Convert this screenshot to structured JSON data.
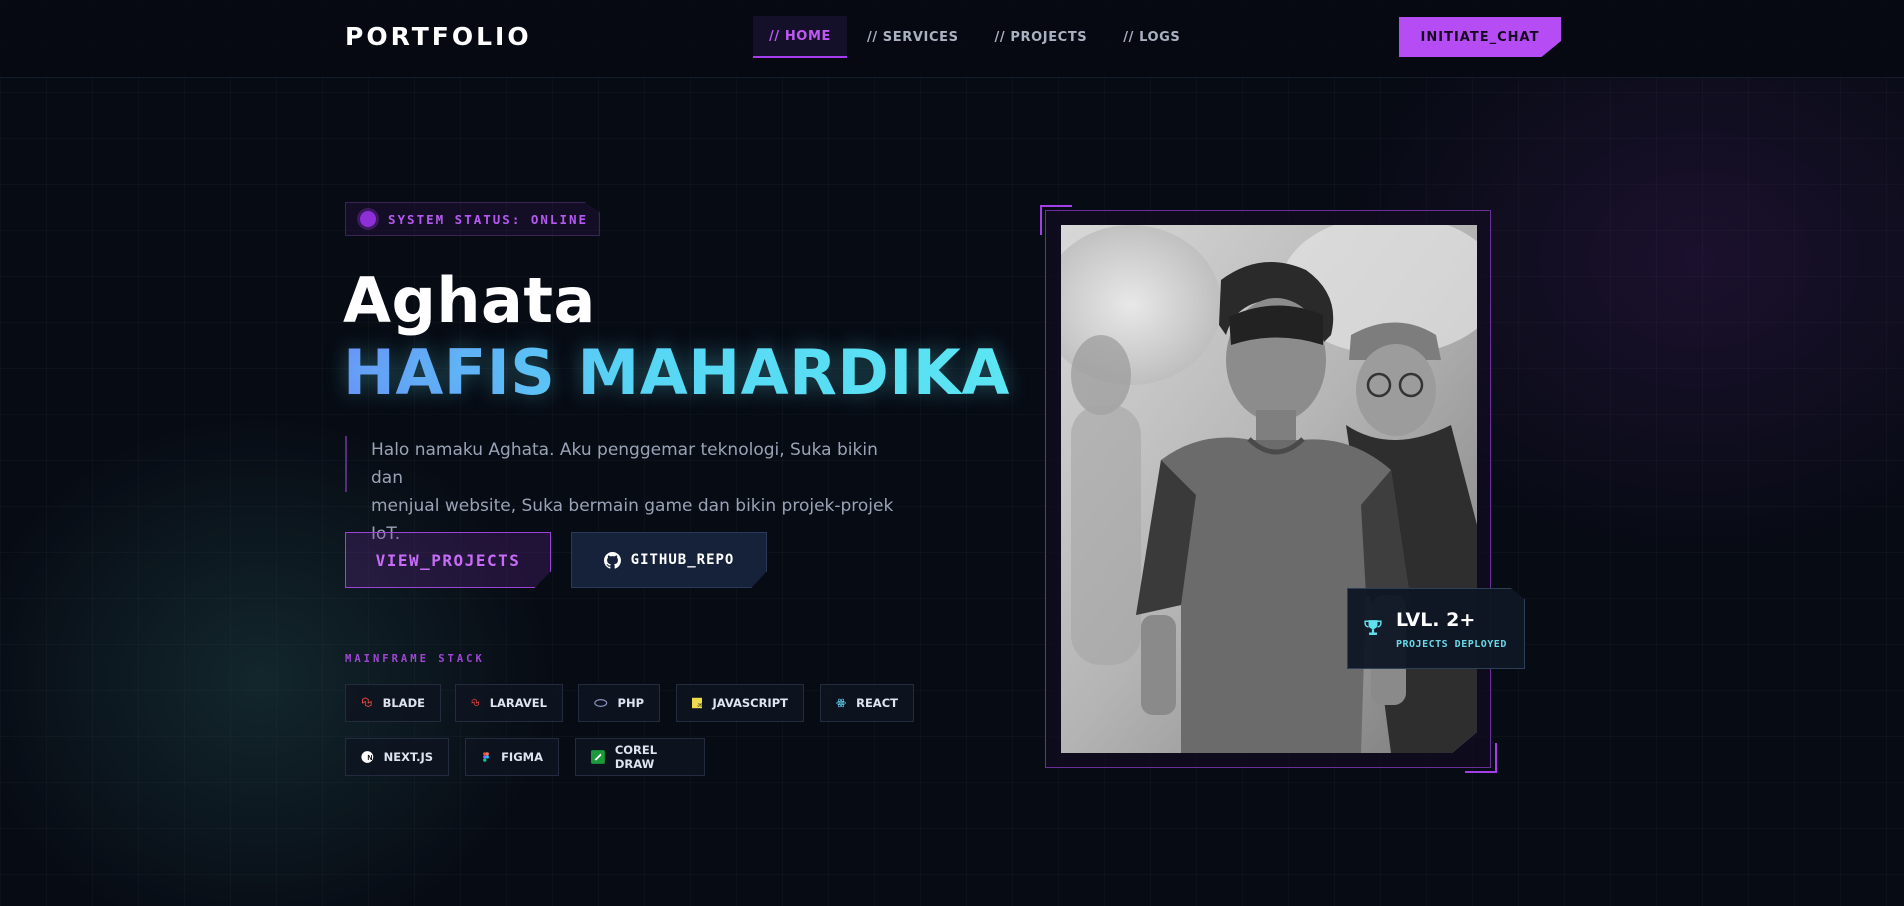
{
  "nav": {
    "logo": "PORTFOLIO",
    "links": [
      "// HOME",
      "// SERVICES",
      "// PROJECTS",
      "// LOGS"
    ],
    "cta": "INITIATE_CHAT"
  },
  "hero": {
    "status": "SYSTEM STATUS: ONLINE",
    "first_name": "Aghata",
    "last_name": "HAFIS MAHARDIKA",
    "intro_line1": "Halo namaku Aghata. Aku penggemar teknologi, Suka bikin dan",
    "intro_line2": "menjual website, Suka bermain game dan bikin projek-projek IoT.",
    "btn_projects": "VIEW_PROJECTS",
    "btn_github": "GITHUB_REPO",
    "stack_title": "MAINFRAME STACK",
    "stack": [
      "BLADE",
      "LARAVEL",
      "PHP",
      "JAVASCRIPT",
      "REACT",
      "NEXT.JS",
      "FIGMA",
      "COREL DRAW"
    ]
  },
  "badge": {
    "title": "LVL. 2+",
    "subtitle": "PROJECTS DEPLOYED"
  },
  "colors": {
    "accent": "#b64cf4",
    "cyan": "#5de8f4",
    "background": "#070b14"
  }
}
